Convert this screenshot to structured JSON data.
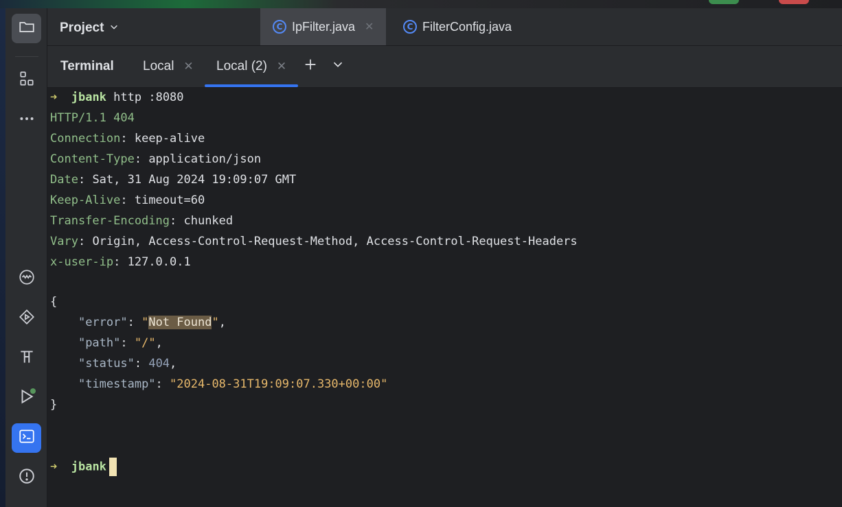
{
  "header": {
    "project_label": "Project",
    "file_tabs": [
      {
        "name": "IpFilter.java",
        "icon": "C",
        "active": true
      },
      {
        "name": "FilterConfig.java",
        "icon": "C",
        "active": false
      }
    ]
  },
  "terminal": {
    "title": "Terminal",
    "tabs": [
      {
        "label": "Local"
      },
      {
        "label": "Local (2)"
      }
    ],
    "command": {
      "arrow": "➜",
      "dir": "jbank",
      "text": "http :8080"
    },
    "status_line": "HTTP/1.1 404",
    "headers": [
      {
        "key": "Connection",
        "value": "keep-alive"
      },
      {
        "key": "Content-Type",
        "value": "application/json"
      },
      {
        "key": "Date",
        "value": "Sat, 31 Aug 2024 19:09:07 GMT"
      },
      {
        "key": "Keep-Alive",
        "value": "timeout=60"
      },
      {
        "key": "Transfer-Encoding",
        "value": "chunked"
      },
      {
        "key": "Vary",
        "value": "Origin, Access-Control-Request-Method, Access-Control-Request-Headers"
      },
      {
        "key": "x-user-ip",
        "value": "127.0.0.1"
      }
    ],
    "body": {
      "open_brace": "{",
      "close_brace": "}",
      "error_key": "\"error\"",
      "error_value": "Not Found",
      "path_key": "\"path\"",
      "path_value": "\"/\"",
      "status_key": "\"status\"",
      "status_value": "404",
      "timestamp_key": "\"timestamp\"",
      "timestamp_value": "\"2024-08-31T19:09:07.330+00:00\""
    },
    "prompt": {
      "arrow": "➜",
      "dir": "jbank"
    }
  },
  "colors": {
    "accent": "#3574f0",
    "header_key": "#91bf8a",
    "json_string": "#e7b86b"
  },
  "icons": [
    "folder-icon",
    "structure-icon",
    "more-icon",
    "services-icon",
    "run-icon",
    "build-icon",
    "run-debug-icon",
    "terminal-icon",
    "problems-icon",
    "plus-icon",
    "chevron-down-icon"
  ]
}
